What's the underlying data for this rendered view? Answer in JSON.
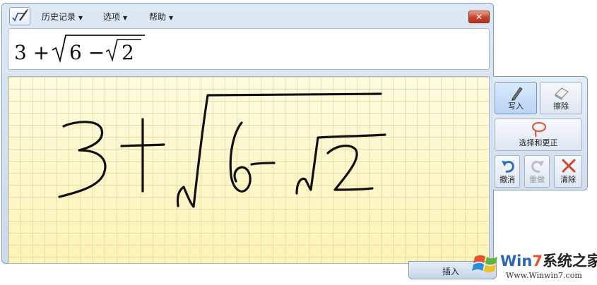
{
  "menu": {
    "history": "历史记录",
    "options": "选项",
    "help": "帮助"
  },
  "preview": {
    "lead": "3 + ",
    "inner_a": "6 − ",
    "inner_b": "2"
  },
  "tools": {
    "write": "写入",
    "erase": "擦除",
    "select_correct": "选择和更正",
    "undo": "撤消",
    "redo": "重做",
    "clear": "清除"
  },
  "insert_button": "插入",
  "watermark": {
    "brand_prefix": "Win",
    "brand_number": "7",
    "brand_cn": "系统之家",
    "url": "Www.Winwin7.com"
  },
  "colors": {
    "accent": "#2d66b5",
    "pad_background": "#fdf8cc",
    "close": "#c7432a"
  },
  "icons": [
    "math-input-app-icon",
    "pen-icon",
    "eraser-icon",
    "lasso-icon",
    "undo-icon",
    "redo-icon",
    "clear-x-icon",
    "windows-logo-icon"
  ]
}
